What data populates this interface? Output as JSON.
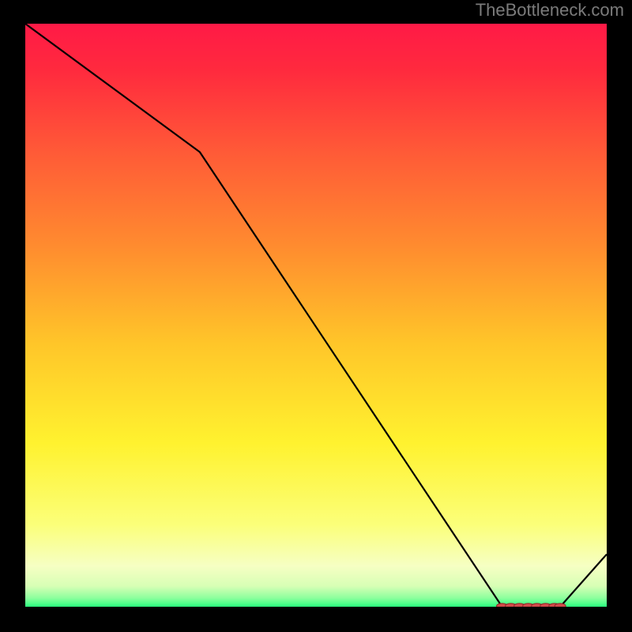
{
  "attribution": "TheBottleneck.com",
  "chart_data": {
    "type": "line",
    "title": "",
    "xlabel": "",
    "ylabel": "",
    "xlim": [
      0,
      100
    ],
    "ylim": [
      0,
      100
    ],
    "x": [
      0,
      30,
      82,
      92,
      100
    ],
    "values": [
      100,
      78,
      0,
      0,
      9
    ],
    "markers": {
      "x": [
        82,
        83.5,
        85,
        86.5,
        88,
        89.5,
        91,
        92
      ],
      "values": [
        0,
        0,
        0,
        0,
        0,
        0,
        0,
        0
      ]
    },
    "gradient_stops": [
      {
        "offset": 0.0,
        "color": "#ff1a46"
      },
      {
        "offset": 0.08,
        "color": "#ff2a3e"
      },
      {
        "offset": 0.22,
        "color": "#ff5a37"
      },
      {
        "offset": 0.38,
        "color": "#ff8b2f"
      },
      {
        "offset": 0.55,
        "color": "#ffc629"
      },
      {
        "offset": 0.72,
        "color": "#fff22f"
      },
      {
        "offset": 0.86,
        "color": "#fbff7a"
      },
      {
        "offset": 0.93,
        "color": "#f6ffc3"
      },
      {
        "offset": 0.965,
        "color": "#d7ffb5"
      },
      {
        "offset": 0.985,
        "color": "#8dff9d"
      },
      {
        "offset": 1.0,
        "color": "#2aff7e"
      }
    ],
    "line_color": "#000000",
    "marker_fill": "#d24a4a",
    "marker_stroke": "#8f2a2a"
  }
}
